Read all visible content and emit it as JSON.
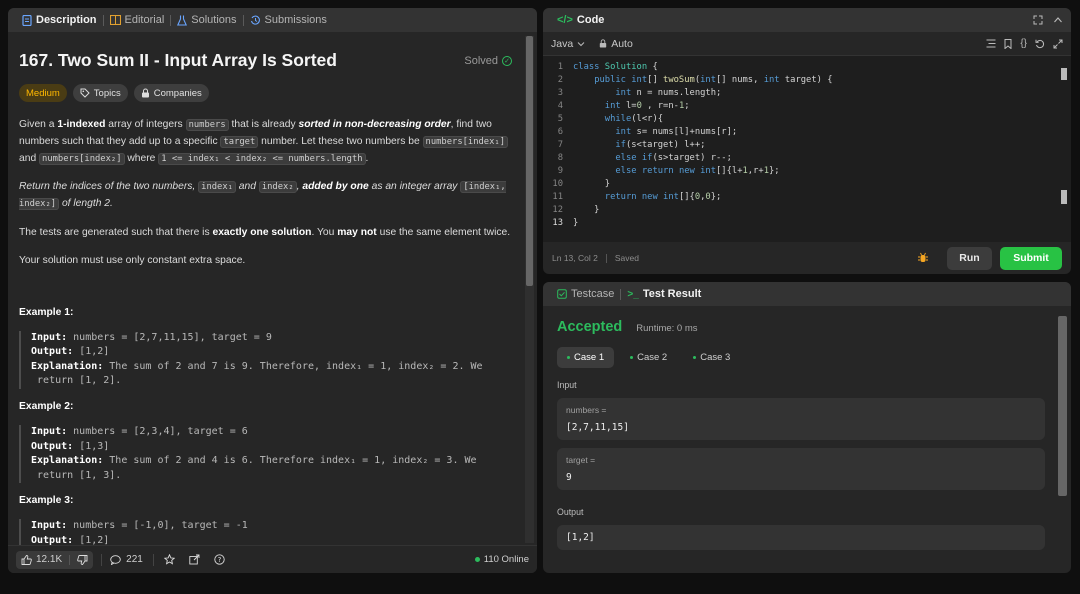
{
  "left_tabs": [
    {
      "label": "Description",
      "icon": "document-icon"
    },
    {
      "label": "Editorial",
      "icon": "book-icon"
    },
    {
      "label": "Solutions",
      "icon": "flask-icon"
    },
    {
      "label": "Submissions",
      "icon": "history-icon"
    }
  ],
  "problem": {
    "title": "167. Two Sum II - Input Array Is Sorted",
    "status": "Solved",
    "difficulty": "Medium",
    "tags": [
      "Topics",
      "Companies"
    ],
    "p1": {
      "a": "Given a ",
      "b": "1-indexed",
      "c": " array of integers ",
      "d": "numbers",
      "e": " that is already ",
      "f": "sorted in non-decreasing order",
      "g": ", find two numbers such that they add up to a specific ",
      "h": "target",
      "i": " number. Let these two numbers be ",
      "j": "numbers[index₁]",
      "k": " and ",
      "l": "numbers[index₂]",
      "m": " where ",
      "n": "1 <= index₁ < index₂ <= numbers.length",
      "o": "."
    },
    "p2": {
      "a": "Return the indices of the two numbers, ",
      "b": "index₁",
      "c": " and ",
      "d": "index₂",
      "e": ", ",
      "f": "added by one",
      "g": " as an integer array ",
      "h": "[index₁, index₂]",
      "i": " of length 2."
    },
    "p3": {
      "a": "The tests are generated such that there is ",
      "b": "exactly one solution",
      "c": ". You ",
      "d": "may not",
      "e": " use the same element twice."
    },
    "p4": "Your solution must use only constant extra space.",
    "examples": [
      {
        "heading": "Example 1:",
        "input": "numbers = [2,7,11,15], target = 9",
        "output": "[1,2]",
        "explanation_1": "The sum of 2 and 7 is 9. Therefore, index₁ = 1, index₂ = 2. We",
        "explanation_2": "return [1, 2]."
      },
      {
        "heading": "Example 2:",
        "input": "numbers = [2,3,4], target = 6",
        "output": "[1,3]",
        "explanation_1": "The sum of 2 and 4 is 6. Therefore index₁ = 1, index₂ = 3. We",
        "explanation_2": "return [1, 3]."
      },
      {
        "heading": "Example 3:",
        "input": "numbers = [-1,0], target = -1",
        "output": "[1,2]"
      }
    ],
    "labels": {
      "input": "Input:",
      "output": "Output:",
      "explanation": "Explanation:"
    }
  },
  "footer": {
    "likes": "12.1K",
    "comments": "221",
    "online": "110 Online"
  },
  "code_panel": {
    "title": "Code",
    "language": "Java",
    "mode": "Auto",
    "status": "Ln 13, Col 2",
    "saved": "Saved",
    "run_label": "Run",
    "submit_label": "Submit",
    "lines": [
      "class Solution {",
      "    public int[] twoSum(int[] nums, int target) {",
      "        int n = nums.length;",
      "      int l=0 , r=n-1;",
      "      while(l<r){",
      "        int s= nums[l]+nums[r];",
      "        if(s<target) l++;",
      "        else if(s>target) r--;",
      "        else return new int[]{l+1,r+1};",
      "      }",
      "      return new int[]{0,0};",
      "    }",
      "}"
    ]
  },
  "result_panel": {
    "tabs": [
      "Testcase",
      "Test Result"
    ],
    "verdict": "Accepted",
    "runtime": "Runtime: 0 ms",
    "cases": [
      "Case 1",
      "Case 2",
      "Case 3"
    ],
    "input_label": "Input",
    "fields": [
      {
        "name": "numbers =",
        "value": "[2,7,11,15]"
      },
      {
        "name": "target =",
        "value": "9"
      }
    ],
    "output_label": "Output",
    "output_value": "[1,2]"
  },
  "colors": {
    "accent_green": "#2cbb5d",
    "medium": "#ffb800",
    "submit": "#28c244"
  }
}
